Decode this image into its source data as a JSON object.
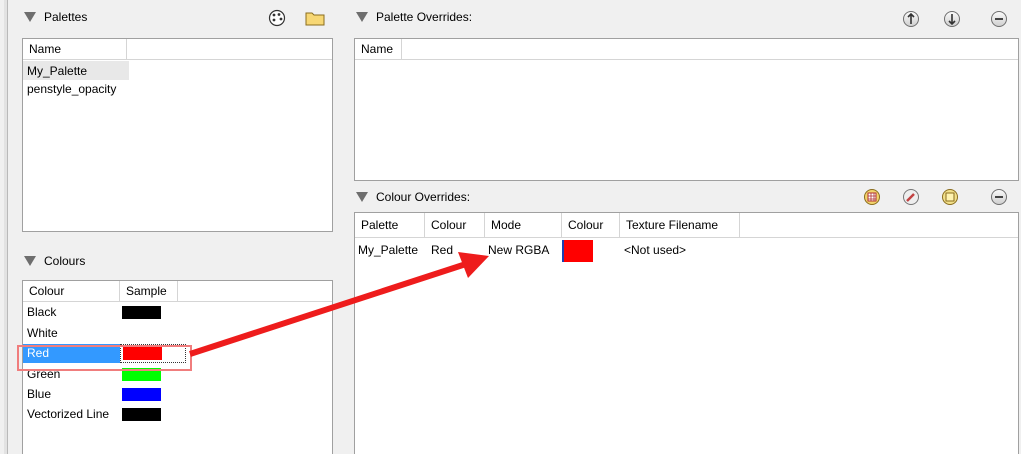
{
  "palettes": {
    "title": "Palettes",
    "column_name": "Name",
    "items": [
      "My_Palette",
      "penstyle_opacity"
    ]
  },
  "palette_overrides": {
    "title": "Palette Overrides:",
    "column_name": "Name"
  },
  "colour_overrides": {
    "title": "Colour Overrides:",
    "columns": [
      "Palette",
      "Colour",
      "Mode",
      "Colour",
      "Texture Filename"
    ],
    "row": {
      "palette": "My_Palette",
      "colour": "Red",
      "mode": "New RGBA",
      "colour_swatch": "#ff0000",
      "texture": "<Not used>"
    }
  },
  "colours": {
    "title": "Colours",
    "columns": [
      "Colour",
      "Sample"
    ],
    "items": [
      {
        "name": "Black",
        "color": "#000000"
      },
      {
        "name": "White",
        "color": "#ffffff"
      },
      {
        "name": "Red",
        "color": "#ff0000",
        "selected": true
      },
      {
        "name": "Green",
        "color": "#00ff00"
      },
      {
        "name": "Blue",
        "color": "#0000ff"
      },
      {
        "name": "Vectorized Line",
        "color": "#000000"
      }
    ]
  },
  "colors": {
    "selection": "#3399ff",
    "annotation_arrow": "#ee1c1c"
  },
  "icons": [
    "palette-browser-icon",
    "folder-icon",
    "move-up-icon",
    "move-down-icon",
    "remove-icon",
    "grid-icon",
    "eyedropper-icon",
    "clone-icon",
    "remove-icon"
  ]
}
